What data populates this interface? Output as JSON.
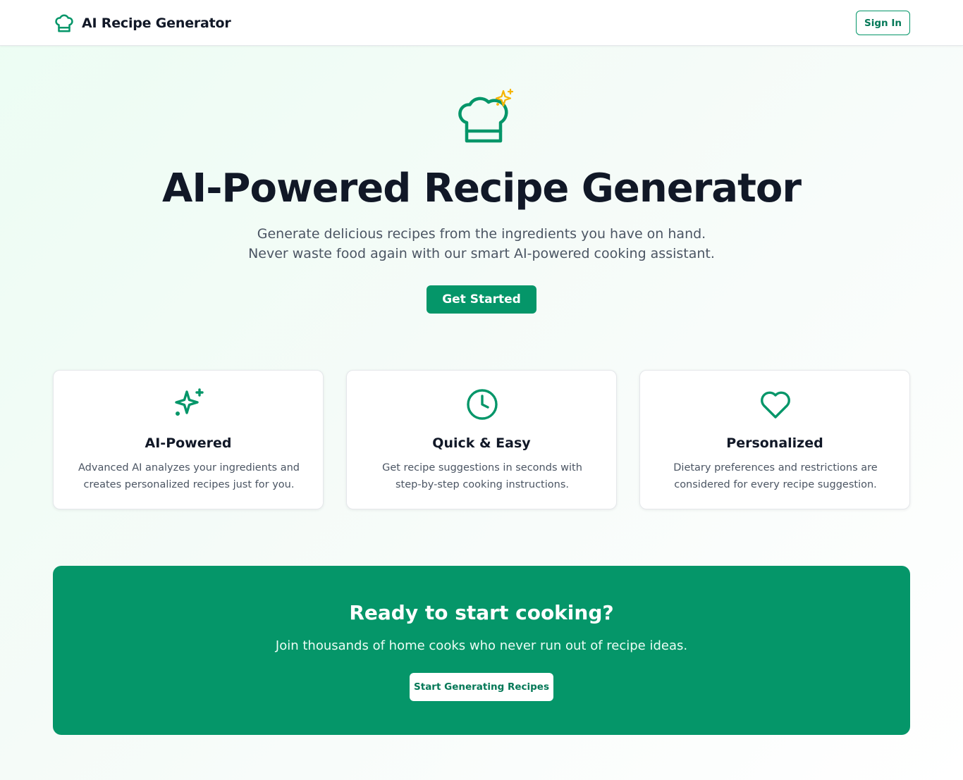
{
  "header": {
    "app_title": "AI Recipe Generator",
    "logo_icon": "chef-hat-icon",
    "signin_label": "Sign In"
  },
  "hero": {
    "icon": "chef-hat-sparkles-icon",
    "title": "AI-Powered Recipe Generator",
    "subtitle": "Generate delicious recipes from the ingredients you have on hand. Never waste food again with our smart AI-powered cooking assistant.",
    "cta_label": "Get Started"
  },
  "features": [
    {
      "icon": "sparkles-icon",
      "title": "AI-Powered",
      "description": "Advanced AI analyzes your ingredients and creates personalized recipes just for you."
    },
    {
      "icon": "clock-icon",
      "title": "Quick & Easy",
      "description": "Get recipe suggestions in seconds with step-by-step cooking instructions."
    },
    {
      "icon": "heart-icon",
      "title": "Personalized",
      "description": "Dietary preferences and restrictions are considered for every recipe suggestion."
    }
  ],
  "banner": {
    "title": "Ready to start cooking?",
    "subtitle": "Join thousands of home cooks who never run out of recipe ideas.",
    "cta_label": "Start Generating Recipes"
  },
  "colors": {
    "accent": "#059669",
    "accent_dark": "#047857",
    "sparkle": "#f5b400",
    "text_dark": "#111827",
    "text_muted": "#4b5563"
  }
}
